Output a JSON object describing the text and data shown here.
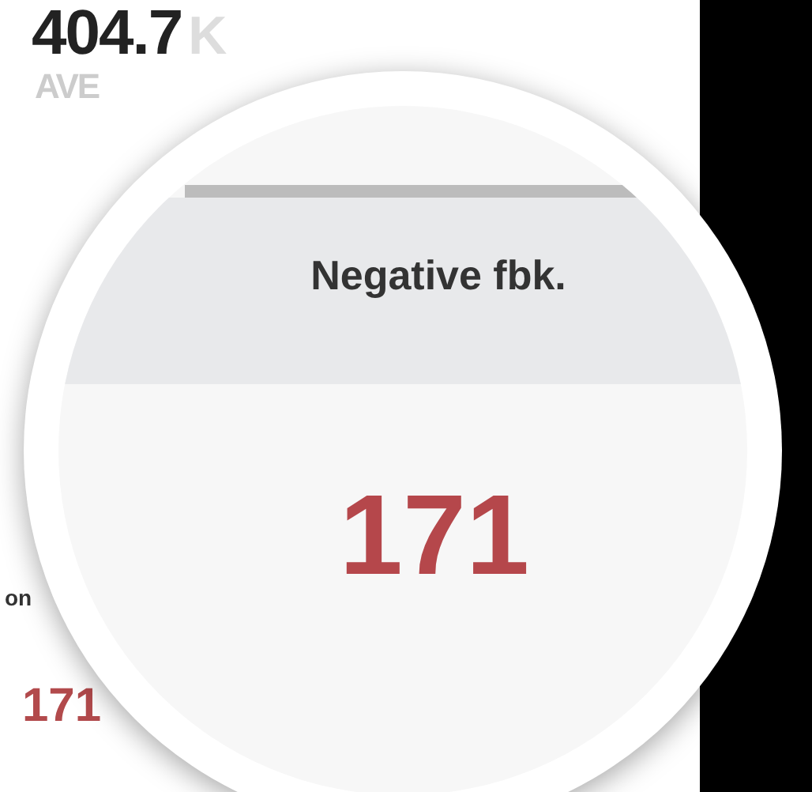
{
  "background": {
    "stat_value": "404.7",
    "stat_unit": "K",
    "stat_label": "AVE",
    "table_header": "on",
    "table_cell": "171"
  },
  "magnifier": {
    "column_header": "Negative fbk.",
    "value": "171"
  }
}
